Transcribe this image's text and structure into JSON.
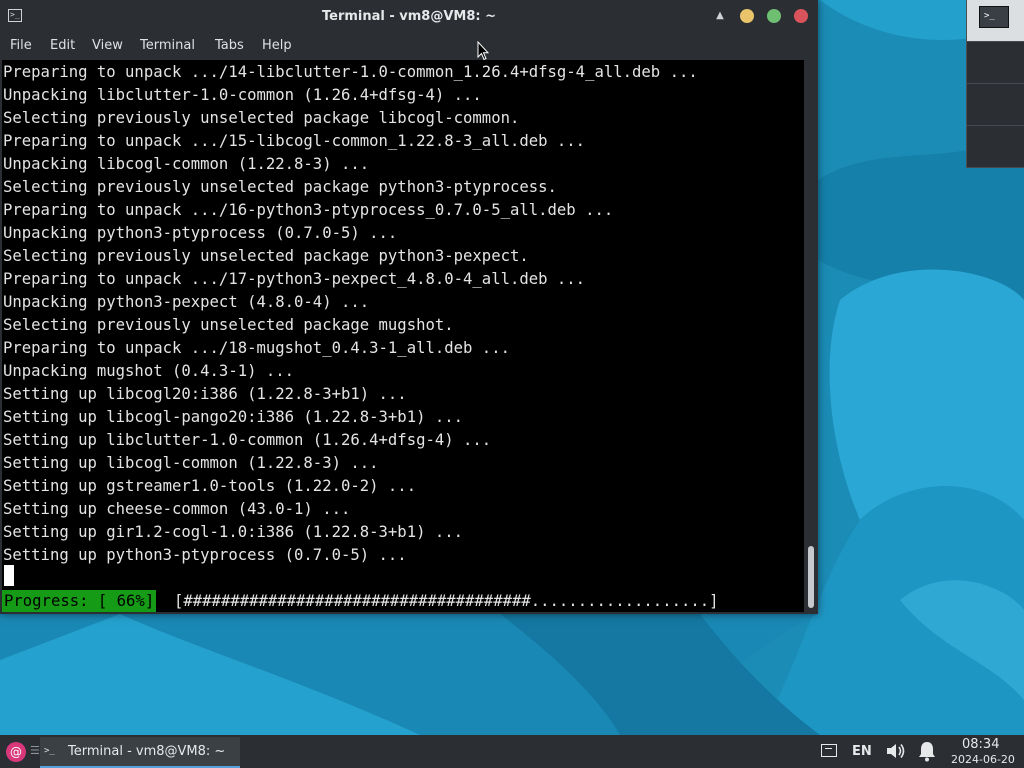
{
  "window": {
    "title": "Terminal - vm8@VM8: ~",
    "app_icon": ">_"
  },
  "menubar": {
    "items": [
      "File",
      "Edit",
      "View",
      "Terminal",
      "Tabs",
      "Help"
    ]
  },
  "terminal": {
    "lines": [
      "Preparing to unpack .../14-libclutter-1.0-common_1.26.4+dfsg-4_all.deb ...",
      "Unpacking libclutter-1.0-common (1.26.4+dfsg-4) ...",
      "Selecting previously unselected package libcogl-common.",
      "Preparing to unpack .../15-libcogl-common_1.22.8-3_all.deb ...",
      "Unpacking libcogl-common (1.22.8-3) ...",
      "Selecting previously unselected package python3-ptyprocess.",
      "Preparing to unpack .../16-python3-ptyprocess_0.7.0-5_all.deb ...",
      "Unpacking python3-ptyprocess (0.7.0-5) ...",
      "Selecting previously unselected package python3-pexpect.",
      "Preparing to unpack .../17-python3-pexpect_4.8.0-4_all.deb ...",
      "Unpacking python3-pexpect (4.8.0-4) ...",
      "Selecting previously unselected package mugshot.",
      "Preparing to unpack .../18-mugshot_0.4.3-1_all.deb ...",
      "Unpacking mugshot (0.4.3-1) ...",
      "Setting up libcogl20:i386 (1.22.8-3+b1) ...",
      "Setting up libcogl-pango20:i386 (1.22.8-3+b1) ...",
      "Setting up libclutter-1.0-common (1.26.4+dfsg-4) ...",
      "Setting up libcogl-common (1.22.8-3) ...",
      "Setting up gstreamer1.0-tools (1.22.0-2) ...",
      "Setting up cheese-common (43.0-1) ...",
      "Setting up gir1.2-cogl-1.0:i386 (1.22.8-3+b1) ...",
      "Setting up python3-ptyprocess (0.7.0-5) ..."
    ],
    "progress_label": "Progress: [ 66%]",
    "progress_bar": "[#####################################...................]",
    "progress_fraction": 0.66
  },
  "pager": {
    "active_window_icon": ">_"
  },
  "taskbar": {
    "start_separator": "☰",
    "task_title": "Terminal - vm8@VM8: ~",
    "task_icon": ">_",
    "language": "EN",
    "clock_time": "08:34",
    "clock_date": "2024-06-20"
  },
  "colors": {
    "window_chrome": "#2b2f33",
    "terminal_bg": "#000000",
    "terminal_fg": "#e4e4e4",
    "progress_green": "#169b16",
    "close_button": "#d9535b",
    "minimize_button": "#e9c46a",
    "maximize_button": "#6fbf73",
    "desktop_blue": "#1d8fb9"
  },
  "icons": {
    "window_app": "terminal-icon",
    "title_menu": "chevron-up-icon",
    "start": "debian-swirl-icon",
    "network": "network-icon",
    "volume": "speaker-icon",
    "notifications": "bell-icon"
  }
}
